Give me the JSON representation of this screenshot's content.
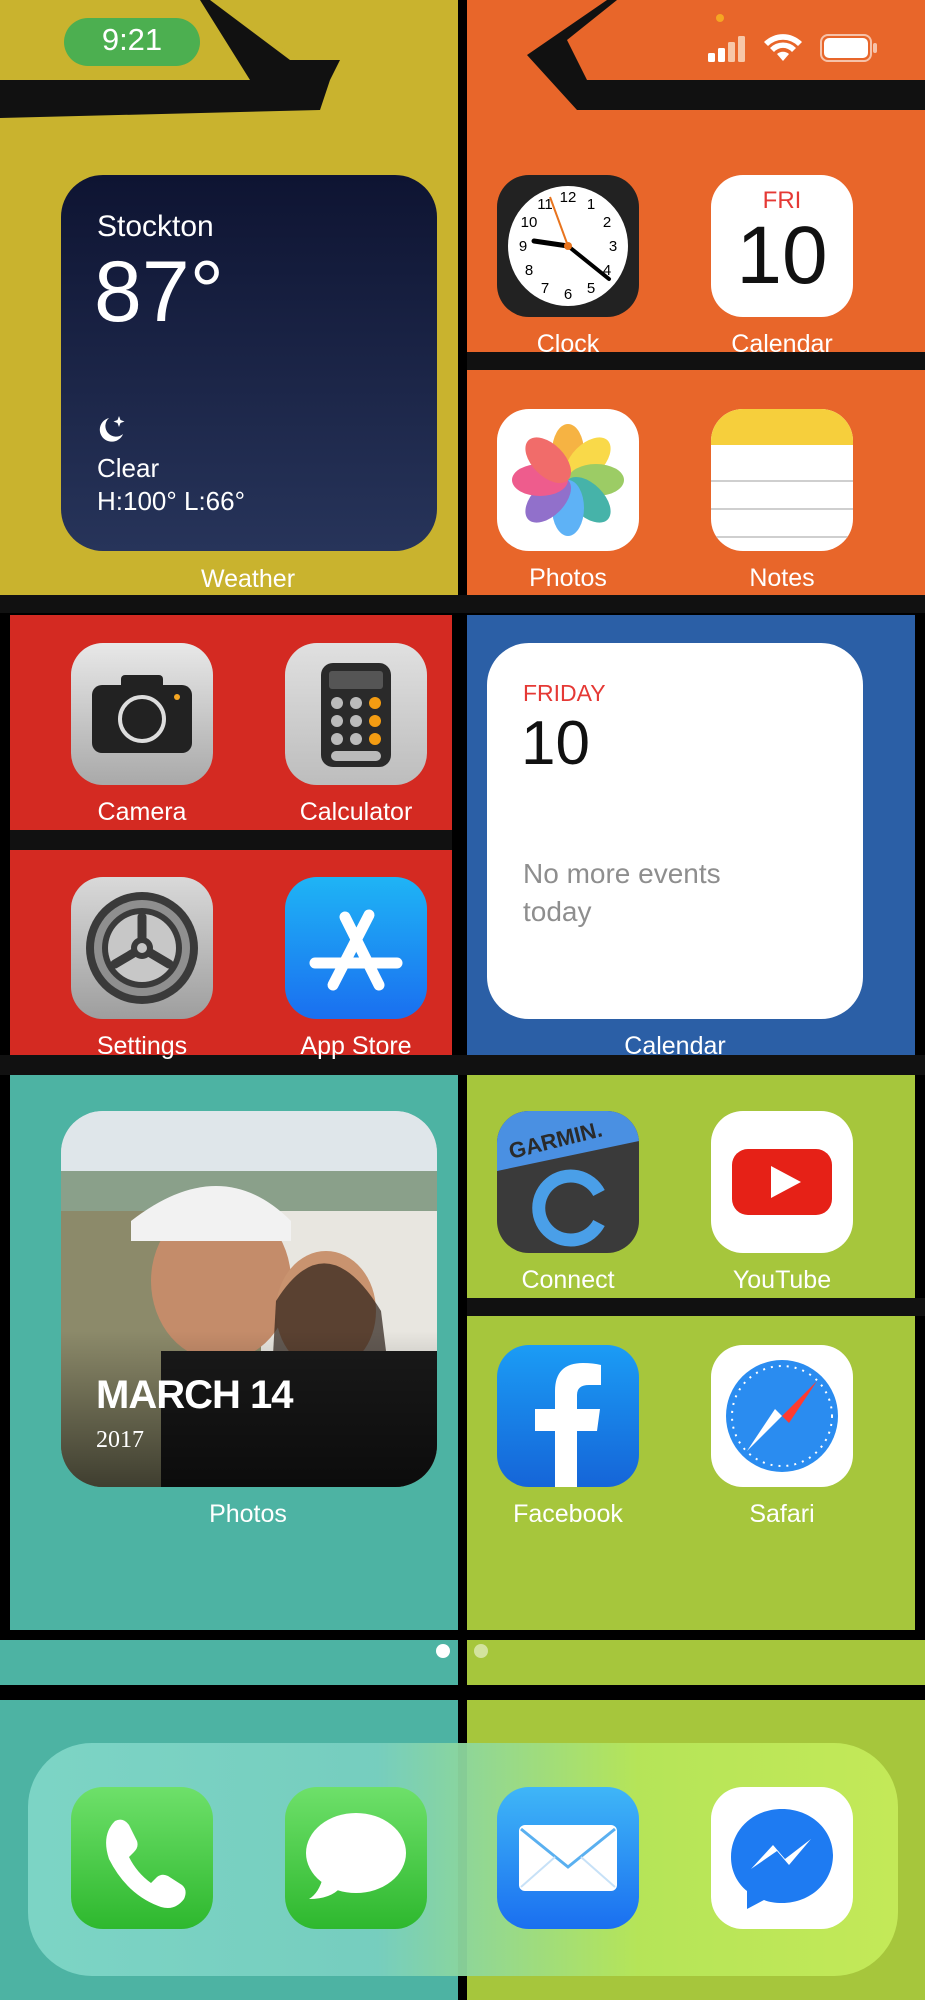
{
  "status_bar": {
    "time": "9:21"
  },
  "weather_widget": {
    "city": "Stockton",
    "temperature": "87°",
    "condition": "Clear",
    "high_low": "H:100° L:66°",
    "icon": "moon-stars-icon",
    "label": "Weather"
  },
  "apps": {
    "clock": "Clock",
    "calendar": "Calendar",
    "calendar_day": "FRI",
    "calendar_date": "10",
    "photos": "Photos",
    "notes": "Notes",
    "camera": "Camera",
    "calculator": "Calculator",
    "settings": "Settings",
    "app_store": "App Store",
    "connect": "Connect",
    "garmin_text": "GARMIN.",
    "youtube": "YouTube",
    "facebook": "Facebook",
    "safari": "Safari"
  },
  "calendar_widget": {
    "weekday": "FRIDAY",
    "date": "10",
    "message": "No more events today",
    "label": "Calendar"
  },
  "photos_widget": {
    "date": "MARCH 14",
    "year": "2017",
    "label": "Photos"
  },
  "page_indicator": {
    "pages": 2,
    "current": 1
  },
  "dock": {
    "apps": [
      "phone-icon",
      "messages-icon",
      "mail-icon",
      "messenger-icon"
    ]
  },
  "colors": {
    "mustard": "#c9b32e",
    "orange": "#e8662a",
    "red": "#d42a22",
    "blue": "#2b5fa6",
    "teal": "#4db3a3",
    "lime": "#a6c63c"
  }
}
